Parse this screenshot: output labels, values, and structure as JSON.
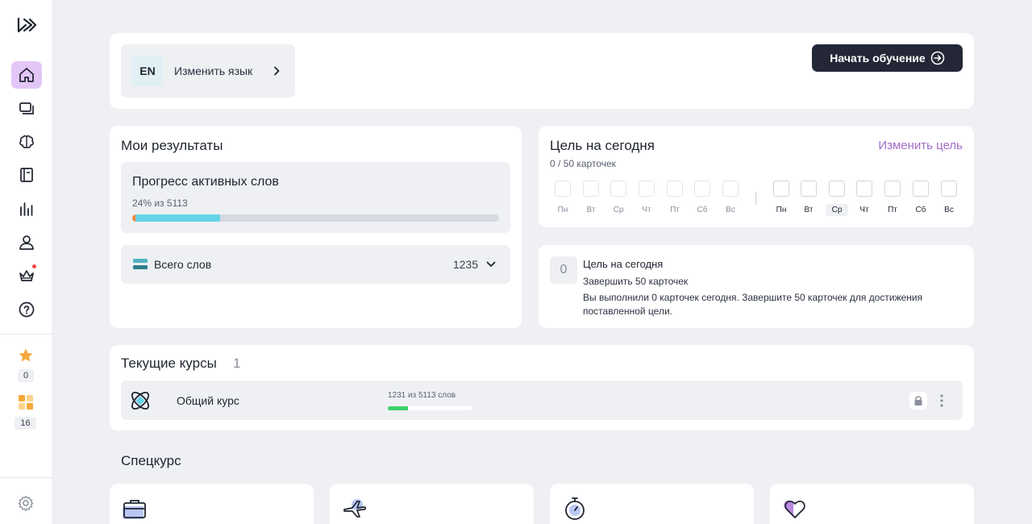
{
  "sidebar": {
    "items": [
      {
        "name": "home",
        "icon": "home-icon"
      },
      {
        "name": "cards",
        "icon": "cards-icon"
      },
      {
        "name": "brain",
        "icon": "brain-icon"
      },
      {
        "name": "dictionary",
        "icon": "book-icon"
      },
      {
        "name": "statistics",
        "icon": "stats-icon"
      },
      {
        "name": "profile",
        "icon": "user-icon"
      },
      {
        "name": "premium",
        "icon": "crown-icon"
      },
      {
        "name": "help",
        "icon": "help-icon"
      }
    ],
    "stars_count": "0",
    "apps_count": "16"
  },
  "language": {
    "code": "EN",
    "label": "Изменить язык"
  },
  "start_button": {
    "label": "Начать обучение"
  },
  "results": {
    "title": "Мои результаты",
    "active_words_title": "Прогресс активных слов",
    "active_words_sub": "24% из 5113",
    "active_words_fraction": 0.24,
    "total_label": "Всего слов",
    "total_value": "1235"
  },
  "goal": {
    "title": "Цель на сегодня",
    "change_label": "Изменить цель",
    "count": "0 / 50 карточек",
    "prev_week": [
      "Пн",
      "Вт",
      "Ср",
      "Чт",
      "Пт",
      "Сб",
      "Вс"
    ],
    "cur_week": [
      "Пн",
      "Вт",
      "Ср",
      "Чт",
      "Пт",
      "Сб",
      "Вс"
    ],
    "today_index": 2
  },
  "goal_detail": {
    "icon": "0",
    "title": "Цель на сегодня",
    "subtitle": "Завершить 50 карточек",
    "description": "Вы выполнили 0 карточек сегодня. Завершите 50 карточек для достижения поставленной цели."
  },
  "courses": {
    "title": "Текущие курсы",
    "count": "1",
    "items": [
      {
        "name": "Общий курс",
        "progress_text": "1231 из 5113 слов",
        "fraction": 0.24
      }
    ]
  },
  "special": {
    "title": "Спецкурс",
    "cards": [
      {
        "icon": "briefcase-icon"
      },
      {
        "icon": "airplane-icon"
      },
      {
        "icon": "stopwatch-icon"
      },
      {
        "icon": "heart-icon"
      }
    ]
  }
}
